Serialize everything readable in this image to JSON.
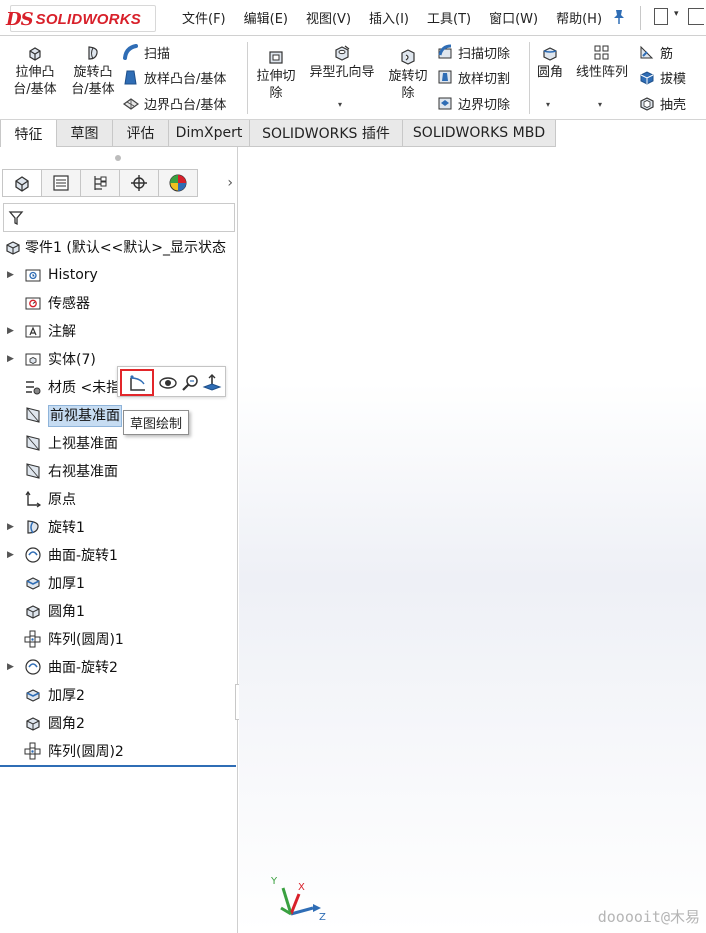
{
  "app": {
    "logo_ds": "DS",
    "logo_name": "SOLIDWORKS"
  },
  "menus": [
    "文件(F)",
    "编辑(E)",
    "视图(V)",
    "插入(I)",
    "工具(T)",
    "窗口(W)",
    "帮助(H)"
  ],
  "command_manager": {
    "extrude_boss": [
      "拉伸凸",
      "台/基体"
    ],
    "revolve_boss": [
      "旋转凸",
      "台/基体"
    ],
    "sweep": "扫描",
    "loft_boss": "放样凸台/基体",
    "boundary_boss": "边界凸台/基体",
    "extrude_cut": [
      "拉伸切",
      "除"
    ],
    "hole_wizard": "异型孔向导",
    "revolve_cut": [
      "旋转切",
      "除"
    ],
    "sweep_cut": "扫描切除",
    "loft_cut": "放样切割",
    "boundary_cut": "边界切除",
    "fillet": "圆角",
    "linear_pattern": "线性阵列",
    "rib": "筋",
    "draft": "拔模",
    "shell": "抽壳"
  },
  "tabs": [
    "特征",
    "草图",
    "评估",
    "DimXpert",
    "SOLIDWORKS 插件",
    "SOLIDWORKS MBD"
  ],
  "active_tab": "特征",
  "feature_tree": {
    "root": "零件1  (默认<<默认>_显示状态",
    "items": [
      {
        "label": "History",
        "icon": "history-folder-icon",
        "expandable": true
      },
      {
        "label": "传感器",
        "icon": "sensor-icon",
        "expandable": false
      },
      {
        "label": "注解",
        "icon": "annotation-icon",
        "expandable": true
      },
      {
        "label": "实体(7)",
        "icon": "solid-bodies-icon",
        "expandable": true
      },
      {
        "label": "材质 <未指",
        "icon": "material-icon",
        "expandable": false
      },
      {
        "label": "前视基准面",
        "icon": "plane-icon",
        "expandable": false,
        "selected": true
      },
      {
        "label": "上视基准面",
        "icon": "plane-icon",
        "expandable": false
      },
      {
        "label": "右视基准面",
        "icon": "plane-icon",
        "expandable": false
      },
      {
        "label": "原点",
        "icon": "origin-icon",
        "expandable": false
      },
      {
        "label": "旋转1",
        "icon": "revolve-feature-icon",
        "expandable": true
      },
      {
        "label": "曲面-旋转1",
        "icon": "surface-revolve-icon",
        "expandable": true
      },
      {
        "label": "加厚1",
        "icon": "thicken-icon",
        "expandable": false
      },
      {
        "label": "圆角1",
        "icon": "fillet-feature-icon",
        "expandable": false
      },
      {
        "label": "阵列(圆周)1",
        "icon": "circular-pattern-icon",
        "expandable": false
      },
      {
        "label": "曲面-旋转2",
        "icon": "surface-revolve-icon",
        "expandable": true
      },
      {
        "label": "加厚2",
        "icon": "thicken-icon",
        "expandable": false
      },
      {
        "label": "圆角2",
        "icon": "fillet-feature-icon",
        "expandable": false
      },
      {
        "label": "阵列(圆周)2",
        "icon": "circular-pattern-icon",
        "expandable": false
      }
    ]
  },
  "context_toolbar": {
    "tooltip": "草图绘制",
    "buttons": [
      "sketch-icon",
      "show-hide-icon",
      "zoom-to-selection-icon",
      "normal-to-icon"
    ]
  },
  "triad": {
    "x": "X",
    "y": "Y",
    "z": "Z"
  },
  "watermark": "dooooit@木易",
  "colors": {
    "brand_red": "#d8202a",
    "selection_blue": "#c6dcf2",
    "highlight_red": "#e2262a",
    "accent_blue": "#2f6db5"
  }
}
